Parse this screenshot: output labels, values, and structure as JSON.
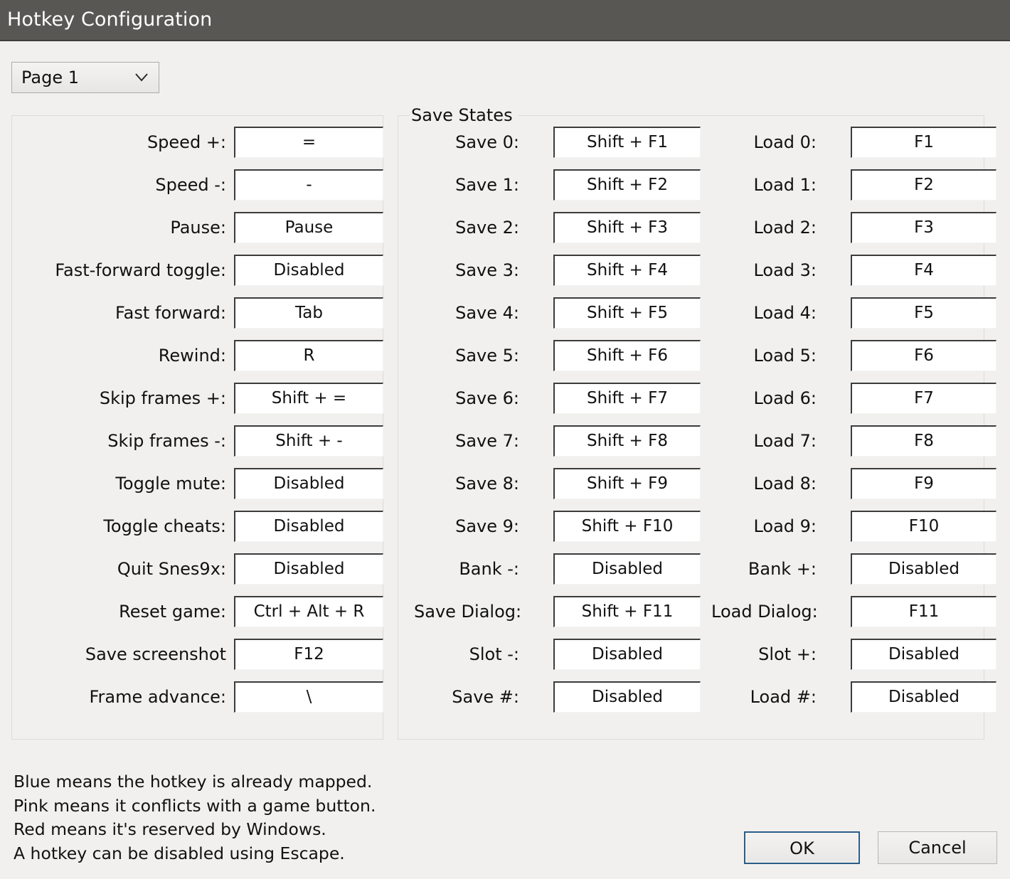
{
  "window": {
    "title": "Hotkey Configuration",
    "background_color": "#f1f0ef",
    "titlebar_color": "#595754"
  },
  "page_select": {
    "value": "Page 1",
    "chevron_icon": "chevron-down-icon"
  },
  "general_group": {
    "rows": [
      {
        "label": "Speed +:",
        "value": "="
      },
      {
        "label": "Speed -:",
        "value": "-"
      },
      {
        "label": "Pause:",
        "value": "Pause"
      },
      {
        "label": "Fast-forward toggle:",
        "value": "Disabled"
      },
      {
        "label": "Fast forward:",
        "value": "Tab"
      },
      {
        "label": "Rewind:",
        "value": "R"
      },
      {
        "label": "Skip frames +:",
        "value": "Shift + ="
      },
      {
        "label": "Skip frames -:",
        "value": "Shift + -"
      },
      {
        "label": "Toggle mute:",
        "value": "Disabled"
      },
      {
        "label": "Toggle cheats:",
        "value": "Disabled"
      },
      {
        "label": "Quit Snes9x:",
        "value": "Disabled"
      },
      {
        "label": "Reset game:",
        "value": "Ctrl + Alt + R"
      },
      {
        "label": "Save screenshot",
        "value": "F12"
      },
      {
        "label": "Frame advance:",
        "value": "\\"
      }
    ]
  },
  "save_states_group": {
    "title": "Save States",
    "save_rows": [
      {
        "label": "Save 0:",
        "value": "Shift + F1"
      },
      {
        "label": "Save 1:",
        "value": "Shift + F2"
      },
      {
        "label": "Save 2:",
        "value": "Shift + F3"
      },
      {
        "label": "Save 3:",
        "value": "Shift + F4"
      },
      {
        "label": "Save 4:",
        "value": "Shift + F5"
      },
      {
        "label": "Save 5:",
        "value": "Shift + F6"
      },
      {
        "label": "Save 6:",
        "value": "Shift + F7"
      },
      {
        "label": "Save 7:",
        "value": "Shift + F8"
      },
      {
        "label": "Save 8:",
        "value": "Shift + F9"
      },
      {
        "label": "Save 9:",
        "value": "Shift + F10"
      },
      {
        "label": "Bank -:",
        "value": "Disabled"
      },
      {
        "label": "Save Dialog:",
        "value": "Shift + F11"
      },
      {
        "label": "Slot -:",
        "value": "Disabled"
      },
      {
        "label": "Save #:",
        "value": "Disabled"
      }
    ],
    "load_rows": [
      {
        "label": "Load 0:",
        "value": "F1"
      },
      {
        "label": "Load 1:",
        "value": "F2"
      },
      {
        "label": "Load 2:",
        "value": "F3"
      },
      {
        "label": "Load 3:",
        "value": "F4"
      },
      {
        "label": "Load 4:",
        "value": "F5"
      },
      {
        "label": "Load 5:",
        "value": "F6"
      },
      {
        "label": "Load 6:",
        "value": "F7"
      },
      {
        "label": "Load 7:",
        "value": "F8"
      },
      {
        "label": "Load 8:",
        "value": "F9"
      },
      {
        "label": "Load 9:",
        "value": "F10"
      },
      {
        "label": "Bank +:",
        "value": "Disabled"
      },
      {
        "label": "Load Dialog:",
        "value": "F11"
      },
      {
        "label": "Slot +:",
        "value": "Disabled"
      },
      {
        "label": "Load #:",
        "value": "Disabled"
      }
    ]
  },
  "help": {
    "lines": [
      "Blue means the hotkey is already mapped.",
      "Pink means it conflicts with a game button.",
      "Red means it's reserved by Windows.",
      "A hotkey can be disabled using Escape."
    ]
  },
  "buttons": {
    "ok": "OK",
    "cancel": "Cancel",
    "ok_focus_color": "#2a5d87"
  }
}
